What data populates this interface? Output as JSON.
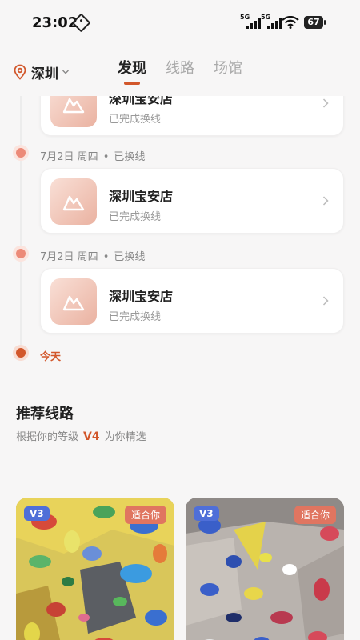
{
  "status_bar": {
    "time": "23:02",
    "network_1": "5G",
    "network_2": "5G",
    "battery": "67"
  },
  "header": {
    "city": "深圳",
    "tabs": [
      {
        "label": "发现",
        "active": true
      },
      {
        "label": "线路",
        "active": false
      },
      {
        "label": "场馆",
        "active": false
      }
    ]
  },
  "timeline": {
    "entries": [
      {
        "date": "7月2日 周四",
        "separator": "•",
        "status": "已换线",
        "gym": "深圳宝安店",
        "detail": "已完成换线"
      },
      {
        "date": "7月2日 周四",
        "separator": "•",
        "status": "已换线",
        "gym": "深圳宝安店",
        "detail": "已完成换线"
      }
    ],
    "partial_card": {
      "gym": "深圳宝安店",
      "detail": "已完成换线"
    },
    "today": "今天"
  },
  "recommend": {
    "title": "推荐线路",
    "sub_prefix": "根据你的等级",
    "level": "V4",
    "sub_suffix": "为你精选",
    "routes": [
      {
        "grade": "V3",
        "tag": "适合你"
      },
      {
        "grade": "V3",
        "tag": "适合你"
      }
    ]
  },
  "colors": {
    "accent": "#d2572b",
    "grade_badge": "#4f6fd8",
    "fit_badge": "#e07560"
  }
}
